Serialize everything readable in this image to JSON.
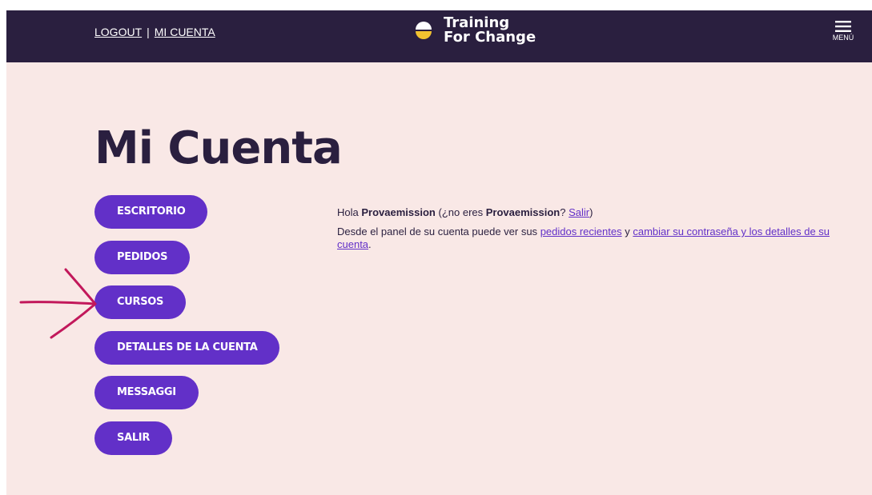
{
  "header": {
    "logout_label": "LOGOUT",
    "separator": "|",
    "account_label": "MI CUENTA",
    "logo_line1": "Training",
    "logo_line2": "For Change",
    "menu_label": "MENÚ"
  },
  "main": {
    "title": "Mi Cuenta",
    "nav": [
      {
        "label": "ESCRITORIO"
      },
      {
        "label": "PEDIDOS"
      },
      {
        "label": "CURSOS"
      },
      {
        "label": "DETALLES DE LA CUENTA"
      },
      {
        "label": "MESSAGGI"
      },
      {
        "label": "SALIR"
      }
    ],
    "greeting": {
      "hello": "Hola",
      "username": "Provaemission",
      "not_you_open": "(¿no eres",
      "username2": "Provaemission",
      "qmark": "?",
      "logout_link": "Salir",
      "close": ")"
    },
    "dashboard": {
      "text1": "Desde el panel de su cuenta puede ver sus",
      "link_orders": "pedidos recientes",
      "text2": "y",
      "link_details": "cambiar su contraseña y los detalles de su cuenta",
      "text3": "."
    }
  },
  "colors": {
    "header_bg": "#2a1f3f",
    "page_bg": "#f9e8e6",
    "accent": "#6230c8",
    "logo_yellow": "#f2c230",
    "annotation_arrow": "#c2185b"
  },
  "icons": {
    "logo": "half-circle-logo-icon",
    "menu": "hamburger-menu-icon",
    "annotation": "hand-drawn-arrow-icon"
  }
}
